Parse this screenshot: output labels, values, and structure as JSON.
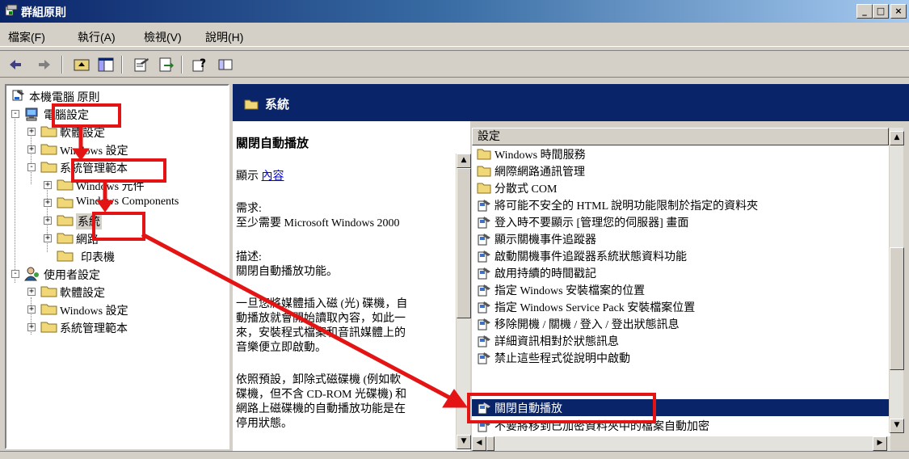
{
  "window": {
    "title": "群組原則",
    "buttons": [
      "_",
      "□",
      "×"
    ]
  },
  "menu": {
    "items": [
      "檔案(F)",
      "執行(A)",
      "檢視(V)",
      "說明(H)"
    ]
  },
  "toolbar": {
    "icons": [
      "back-icon",
      "forward-icon",
      "up-folder-icon",
      "show-tree-icon",
      "properties-icon",
      "export-list-icon",
      "help-icon",
      "extended-view-icon"
    ]
  },
  "tree": {
    "root": "本機電腦 原則",
    "computer_config": "電腦設定",
    "cc_software": "軟體設定",
    "cc_windows": "Windows 設定",
    "cc_admin": "系統管理範本",
    "cc_admin_components": "Windows 元件",
    "cc_admin_wincomponents": "Windows Components",
    "cc_admin_system": "系統",
    "cc_admin_network": "網路",
    "cc_admin_printers": "印表機",
    "user_config": "使用者設定",
    "uc_software": "軟體設定",
    "uc_windows": "Windows 設定",
    "uc_admin": "系統管理範本"
  },
  "header": {
    "title": "系統"
  },
  "description": {
    "title": "關閉自動播放",
    "show_prefix": "顯示",
    "show_link": "內容",
    "req_label": "需求:",
    "req_value": "至少需要 Microsoft Windows 2000",
    "desc_label": "描述:",
    "desc_value": "關閉自動播放功能。",
    "para1_l1": "一旦您將媒體插入磁 (光) 碟機，自",
    "para1_l2": "動播放就會開始讀取內容，如此一",
    "para1_l3": "來，安裝程式檔案和音訊媒體上的",
    "para1_l4": "音樂便立即啟動。",
    "para2_l1": "依照預設，卸除式磁碟機 (例如軟",
    "para2_l2": "碟機，但不含 CD-ROM 光碟機) 和",
    "para2_l3": "網路上磁碟機的自動播放功能是在",
    "para2_l4": "停用狀態。"
  },
  "list": {
    "column_header": "設定",
    "rows": [
      {
        "label": "Windows 時間服務",
        "icon": "folder-icon"
      },
      {
        "label": "網際網路通訊管理",
        "icon": "folder-icon"
      },
      {
        "label": "分散式 COM",
        "icon": "folder-icon"
      },
      {
        "label": "將可能不安全的 HTML 說明功能限制於指定的資料夾",
        "icon": "setting-icon"
      },
      {
        "label": "登入時不要顯示 [管理您的伺服器] 畫面",
        "icon": "setting-icon"
      },
      {
        "label": "顯示關機事件追蹤器",
        "icon": "setting-icon"
      },
      {
        "label": "啟動關機事件追蹤器系統狀態資料功能",
        "icon": "setting-icon"
      },
      {
        "label": "啟用持續的時間戳記",
        "icon": "setting-icon"
      },
      {
        "label": "指定 Windows 安裝檔案的位置",
        "icon": "setting-icon"
      },
      {
        "label": "指定 Windows Service Pack 安裝檔案位置",
        "icon": "setting-icon"
      },
      {
        "label": "移除開機 / 關機 / 登入 / 登出狀態訊息",
        "icon": "setting-icon"
      },
      {
        "label": "詳細資訊相對於狀態訊息",
        "icon": "setting-icon"
      },
      {
        "label": "禁止這些程式從說明中啟動",
        "icon": "setting-icon"
      },
      {
        "label": "關閉自動播放",
        "icon": "setting-icon",
        "selected": true
      },
      {
        "label": "不要將移到已加密資料夾中的檔案自動加密",
        "icon": "setting-icon"
      }
    ]
  },
  "colors": {
    "annotation": "#e51414",
    "selection": "#0a246a",
    "link": "#0000ee"
  }
}
